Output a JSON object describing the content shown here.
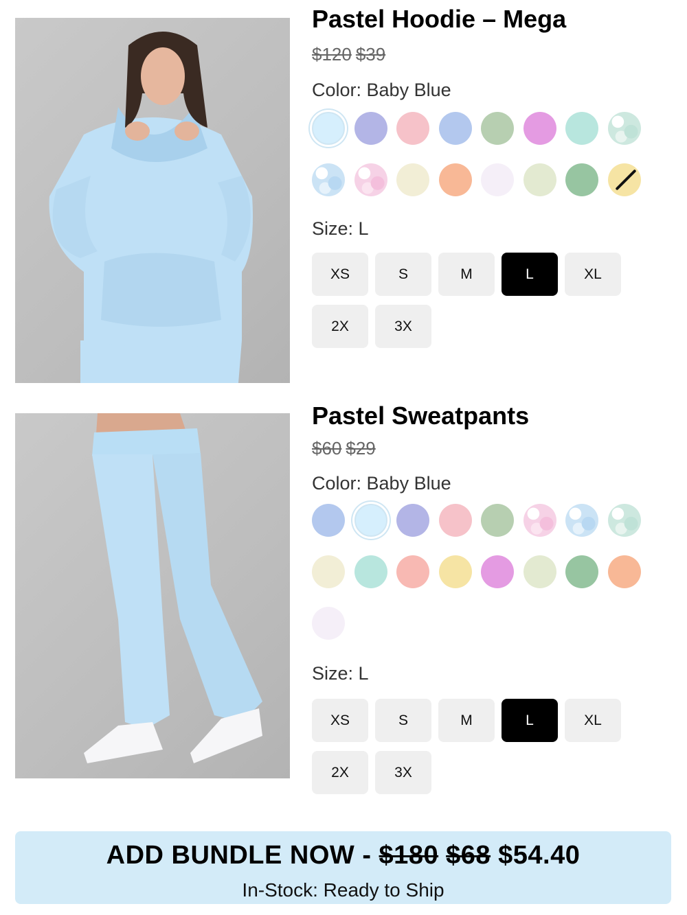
{
  "products": [
    {
      "title": "Pastel Hoodie – Mega",
      "price_original": "$120",
      "price_sale": "$39",
      "color_label": "Color: Baby Blue",
      "size_label": "Size: L",
      "swatch_colors": [
        "#d6effd",
        "#b3b5e6",
        "#f6c2c9",
        "#b3c8ee",
        "#b7cfb1",
        "#e49be2",
        "#b8e6de",
        "camo-mint",
        "camo-blue",
        "camo-pink",
        "#f2eed6",
        "#f8b896",
        "#f5eff8",
        "#e3ead1",
        "#97c5a1",
        "#f6e4a4"
      ],
      "selected_swatch": 0,
      "sold_out_swatch": 15,
      "sizes": [
        "XS",
        "S",
        "M",
        "L",
        "XL",
        "2X",
        "3X"
      ],
      "selected_size": "L"
    },
    {
      "title": "Pastel Sweatpants",
      "price_original": "$60",
      "price_sale": "$29",
      "color_label": "Color: Baby Blue",
      "size_label": "Size: L",
      "swatch_colors": [
        "#b3c8ee",
        "#d6effd",
        "#b3b5e6",
        "#f6c2c9",
        "#b7cfb1",
        "camo-pink",
        "camo-blue",
        "camo-mint",
        "#f2eed6",
        "#b8e6de",
        "#f8b9b3",
        "#f6e4a4",
        "#e49be2",
        "#e3ead1",
        "#97c5a1",
        "#f8b896",
        "#f5eff8"
      ],
      "selected_swatch": 1,
      "sold_out_swatch": -1,
      "sizes": [
        "XS",
        "S",
        "M",
        "L",
        "XL",
        "2X",
        "3X"
      ],
      "selected_size": "L"
    }
  ],
  "bundle": {
    "prefix": "ADD BUNDLE NOW - ",
    "price_original": "$180",
    "price_compare": "$68",
    "price_final": "$54.40",
    "stock_text": "In-Stock: Ready to Ship"
  }
}
